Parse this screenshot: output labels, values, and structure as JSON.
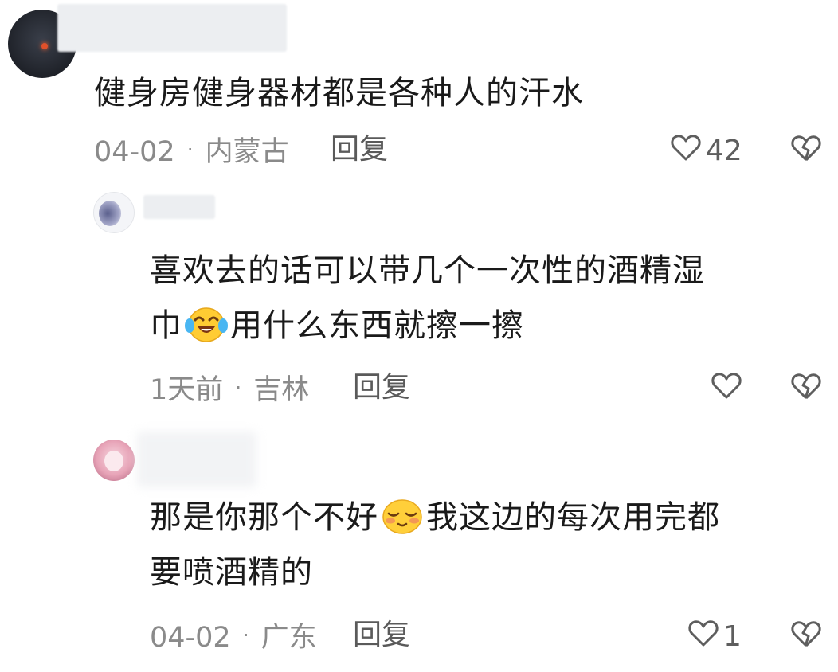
{
  "comments": [
    {
      "text": "健身房健身器材都是各种人的汗水",
      "date": "04-02",
      "sep": "·",
      "location": "内蒙古",
      "reply_label": "回复",
      "like_count": "42",
      "icons": {
        "like": "heart-outline-icon",
        "dislike": "broken-heart-icon"
      }
    },
    {
      "text_line1": "喜欢去的话可以带几个一次性的酒精湿",
      "text_line2_a": "巾",
      "emoji": "laugh-cry-emoji",
      "text_line2_b": "用什么东西就擦一擦",
      "date": "1天前",
      "sep": "·",
      "location": "吉林",
      "reply_label": "回复",
      "like_count": "",
      "icons": {
        "like": "heart-outline-icon",
        "dislike": "broken-heart-icon"
      }
    },
    {
      "text_line1_a": "那是你那个不好",
      "emoji": "shy-smile-emoji",
      "text_line1_b": "我这边的每次用完都",
      "text_line2": "要喷酒精的",
      "date": "04-02",
      "sep": "·",
      "location": "广东",
      "reply_label": "回复",
      "like_count": "1",
      "icons": {
        "like": "heart-outline-icon",
        "dislike": "broken-heart-icon"
      }
    }
  ],
  "colors": {
    "text": "#1a1a1a",
    "meta": "#8a8a8a",
    "icon": "#5e5e5e"
  }
}
